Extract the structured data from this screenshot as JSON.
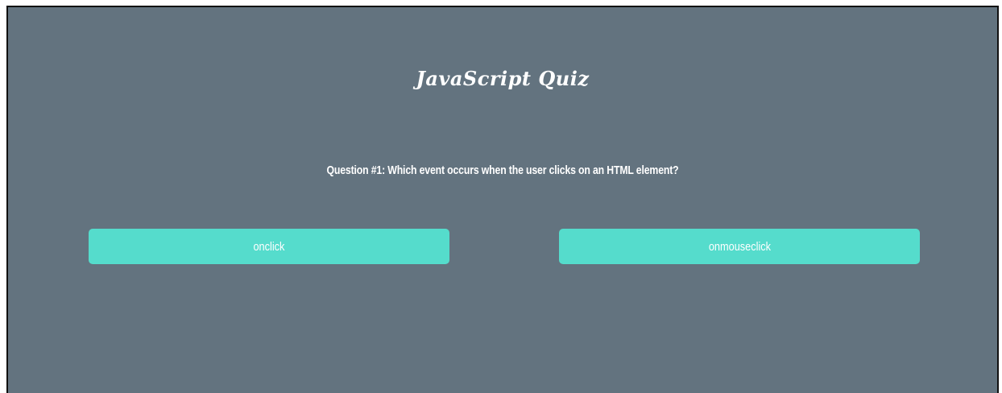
{
  "quiz": {
    "title": "JavaScript Quiz",
    "question": "Question #1: Which event occurs when the user clicks on an HTML element?",
    "answers": [
      {
        "label": "onclick"
      },
      {
        "label": "onmouseclick"
      }
    ]
  },
  "colors": {
    "background": "#63737f",
    "button": "#55dccc",
    "text": "#ffffff"
  }
}
